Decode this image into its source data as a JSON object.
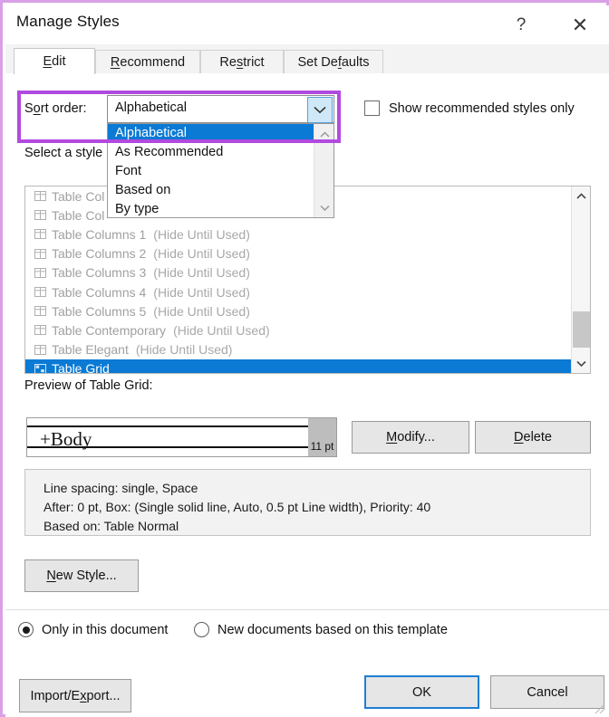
{
  "window": {
    "title": "Manage Styles",
    "help_icon": "question-mark-icon",
    "close_icon": "close-icon"
  },
  "tabs": [
    {
      "label": "Edit",
      "mnemonic": "E",
      "active": true
    },
    {
      "label": "Recommend",
      "mnemonic": "R",
      "active": false
    },
    {
      "label": "Restrict",
      "mnemonic": "s",
      "active": false
    },
    {
      "label": "Set Defaults",
      "mnemonic": "f",
      "active": false
    }
  ],
  "sort_order": {
    "label": "Sort order:",
    "label_pre": "S",
    "label_mn": "o",
    "label_post": "rt order:",
    "value": "Alphabetical",
    "expanded": true,
    "highlight_color": "#b24ae0",
    "options": [
      {
        "label": "Alphabetical",
        "selected": true
      },
      {
        "label": "As Recommended",
        "selected": false
      },
      {
        "label": "Font",
        "selected": false
      },
      {
        "label": "Based on",
        "selected": false
      },
      {
        "label": "By type",
        "selected": false
      }
    ]
  },
  "show_recommended": {
    "label": "Show recommended styles only",
    "checked": false
  },
  "select_style_label": "Select a style",
  "style_list": {
    "selection_color": "#0a7ad4",
    "items": [
      {
        "name": "Table Col",
        "hint": "",
        "selected": false,
        "clipped": true
      },
      {
        "name": "Table Col",
        "hint": "",
        "selected": false,
        "clipped": true
      },
      {
        "name": "Table Columns 1",
        "hint": "(Hide Until Used)",
        "selected": false
      },
      {
        "name": "Table Columns 2",
        "hint": "(Hide Until Used)",
        "selected": false
      },
      {
        "name": "Table Columns 3",
        "hint": "(Hide Until Used)",
        "selected": false
      },
      {
        "name": "Table Columns 4",
        "hint": "(Hide Until Used)",
        "selected": false
      },
      {
        "name": "Table Columns 5",
        "hint": "(Hide Until Used)",
        "selected": false
      },
      {
        "name": "Table Contemporary",
        "hint": "(Hide Until Used)",
        "selected": false
      },
      {
        "name": "Table Elegant",
        "hint": "(Hide Until Used)",
        "selected": false
      },
      {
        "name": "Table Grid",
        "hint": "",
        "selected": true
      }
    ]
  },
  "preview": {
    "label": "Preview of Table Grid:",
    "sample_text": "+Body",
    "font_size": "11 pt"
  },
  "actions": {
    "modify": "Modify...",
    "modify_mn": "M",
    "modify_rest": "odify...",
    "delete": "Delete",
    "delete_mn": "D",
    "delete_rest": "elete",
    "new_style": "New Style...",
    "new_style_mn": "N",
    "new_style_rest": "ew Style..."
  },
  "description": {
    "lines": [
      "Line spacing:  single, Space",
      "After:  0 pt, Box: (Single solid line, Auto,  0.5 pt Line width), Priority: 40",
      "Based on: Table Normal"
    ]
  },
  "scope": {
    "options": [
      {
        "label": "Only in this document",
        "selected": true
      },
      {
        "label": "New documents based on this template",
        "selected": false
      }
    ]
  },
  "footer": {
    "import_export": "Import/Export...",
    "import_pre": "Import/E",
    "import_mn": "x",
    "import_post": "port...",
    "ok": "OK",
    "cancel": "Cancel",
    "default_button": "OK"
  }
}
